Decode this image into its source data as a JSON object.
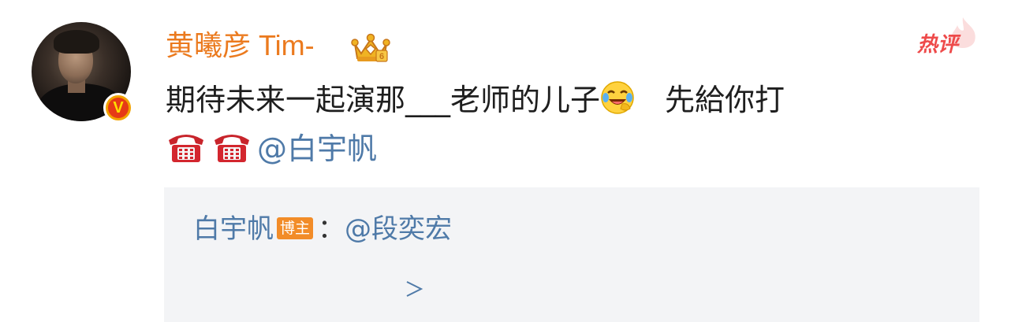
{
  "comment": {
    "username": "黄曦彦 Tim-",
    "hot_label": "热评",
    "text_line1": "期待未来一起演那___老师的儿子",
    "text_after_emoji": "先給你打",
    "mention": "@白宇帆",
    "icons": [
      "crown-badge-icon",
      "verified-v-icon",
      "laugh-cry-emoji",
      "telephone-emoji"
    ]
  },
  "quote": {
    "author": "白宇帆",
    "badge": "博主",
    "colon": "：",
    "mention": "@段奕宏"
  },
  "colors": {
    "username": "#eb7a1e",
    "link": "#4f7aa8",
    "hot": "#ee4a4a",
    "quote_bg": "#f3f4f6"
  }
}
